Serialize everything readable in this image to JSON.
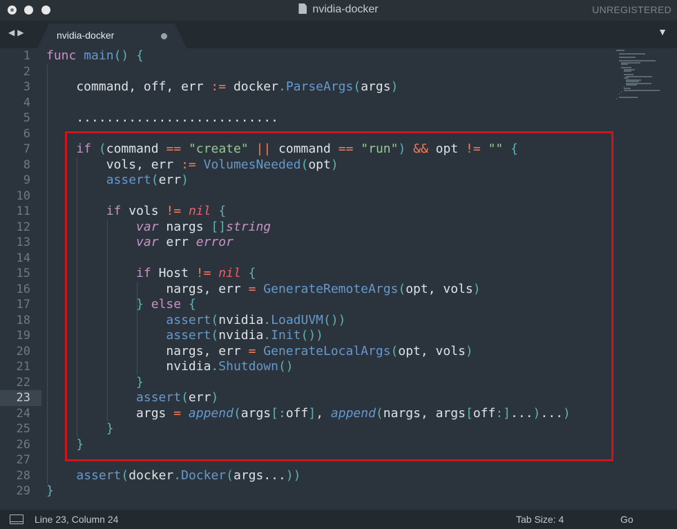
{
  "window": {
    "title": "nvidia-docker",
    "license_status": "UNREGISTERED"
  },
  "tabbar": {
    "nav_back": "◀",
    "nav_forward": "▶",
    "active_tab": "nvidia-docker",
    "menu_glyph": "▼"
  },
  "editor": {
    "active_line": 23,
    "line_numbers": [
      "1",
      "2",
      "3",
      "4",
      "5",
      "6",
      "7",
      "8",
      "9",
      "10",
      "11",
      "12",
      "13",
      "14",
      "15",
      "16",
      "17",
      "18",
      "19",
      "20",
      "21",
      "22",
      "23",
      "24",
      "25",
      "26",
      "27",
      "28",
      "29"
    ],
    "lines": [
      [
        [
          "k",
          "func"
        ],
        [
          "t",
          " "
        ],
        [
          "f",
          "main"
        ],
        [
          "p",
          "()"
        ],
        [
          "t",
          " "
        ],
        [
          "p",
          "{"
        ]
      ],
      [],
      [
        [
          "t",
          "    command, off, err "
        ],
        [
          "o",
          ":="
        ],
        [
          "t",
          " docker"
        ],
        [
          "p",
          "."
        ],
        [
          "f",
          "ParseArgs"
        ],
        [
          "p",
          "("
        ],
        [
          "t",
          "args"
        ],
        [
          "p",
          ")"
        ]
      ],
      [],
      [
        [
          "t",
          "    ..........................."
        ]
      ],
      [],
      [
        [
          "t",
          "    "
        ],
        [
          "k",
          "if"
        ],
        [
          "t",
          " "
        ],
        [
          "p",
          "("
        ],
        [
          "t",
          "command "
        ],
        [
          "o",
          "=="
        ],
        [
          "t",
          " "
        ],
        [
          "s",
          "\"create\""
        ],
        [
          "t",
          " "
        ],
        [
          "o",
          "||"
        ],
        [
          "t",
          " command "
        ],
        [
          "o",
          "=="
        ],
        [
          "t",
          " "
        ],
        [
          "s",
          "\"run\""
        ],
        [
          "p",
          ")"
        ],
        [
          "t",
          " "
        ],
        [
          "o",
          "&&"
        ],
        [
          "t",
          " opt "
        ],
        [
          "o",
          "!="
        ],
        [
          "t",
          " "
        ],
        [
          "s",
          "\"\""
        ],
        [
          "t",
          " "
        ],
        [
          "p",
          "{"
        ]
      ],
      [
        [
          "t",
          "        vols, err "
        ],
        [
          "o",
          ":="
        ],
        [
          "t",
          " "
        ],
        [
          "f",
          "VolumesNeeded"
        ],
        [
          "p",
          "("
        ],
        [
          "t",
          "opt"
        ],
        [
          "p",
          ")"
        ]
      ],
      [
        [
          "t",
          "        "
        ],
        [
          "f",
          "assert"
        ],
        [
          "p",
          "("
        ],
        [
          "t",
          "err"
        ],
        [
          "p",
          ")"
        ]
      ],
      [],
      [
        [
          "t",
          "        "
        ],
        [
          "k",
          "if"
        ],
        [
          "t",
          " vols "
        ],
        [
          "o",
          "!="
        ],
        [
          "t",
          " "
        ],
        [
          "n",
          "nil"
        ],
        [
          "t",
          " "
        ],
        [
          "p",
          "{"
        ]
      ],
      [
        [
          "t",
          "            "
        ],
        [
          "ki",
          "var"
        ],
        [
          "t",
          " nargs "
        ],
        [
          "p",
          "[]"
        ],
        [
          "ki",
          "string"
        ]
      ],
      [
        [
          "t",
          "            "
        ],
        [
          "ki",
          "var"
        ],
        [
          "t",
          " err "
        ],
        [
          "ki",
          "error"
        ]
      ],
      [],
      [
        [
          "t",
          "            "
        ],
        [
          "k",
          "if"
        ],
        [
          "t",
          " Host "
        ],
        [
          "o",
          "!="
        ],
        [
          "t",
          " "
        ],
        [
          "n",
          "nil"
        ],
        [
          "t",
          " "
        ],
        [
          "p",
          "{"
        ]
      ],
      [
        [
          "t",
          "                nargs, err "
        ],
        [
          "o",
          "="
        ],
        [
          "t",
          " "
        ],
        [
          "f",
          "GenerateRemoteArgs"
        ],
        [
          "p",
          "("
        ],
        [
          "t",
          "opt, vols"
        ],
        [
          "p",
          ")"
        ]
      ],
      [
        [
          "t",
          "            "
        ],
        [
          "p",
          "}"
        ],
        [
          "t",
          " "
        ],
        [
          "k",
          "else"
        ],
        [
          "t",
          " "
        ],
        [
          "p",
          "{"
        ]
      ],
      [
        [
          "t",
          "                "
        ],
        [
          "f",
          "assert"
        ],
        [
          "p",
          "("
        ],
        [
          "t",
          "nvidia"
        ],
        [
          "p",
          "."
        ],
        [
          "f",
          "LoadUVM"
        ],
        [
          "p",
          "())"
        ]
      ],
      [
        [
          "t",
          "                "
        ],
        [
          "f",
          "assert"
        ],
        [
          "p",
          "("
        ],
        [
          "t",
          "nvidia"
        ],
        [
          "p",
          "."
        ],
        [
          "f",
          "Init"
        ],
        [
          "p",
          "())"
        ]
      ],
      [
        [
          "t",
          "                nargs, err "
        ],
        [
          "o",
          "="
        ],
        [
          "t",
          " "
        ],
        [
          "f",
          "GenerateLocalArgs"
        ],
        [
          "p",
          "("
        ],
        [
          "t",
          "opt, vols"
        ],
        [
          "p",
          ")"
        ]
      ],
      [
        [
          "t",
          "                nvidia"
        ],
        [
          "p",
          "."
        ],
        [
          "f",
          "Shutdown"
        ],
        [
          "p",
          "()"
        ]
      ],
      [
        [
          "t",
          "            "
        ],
        [
          "p",
          "}"
        ]
      ],
      [
        [
          "t",
          "            "
        ],
        [
          "f",
          "assert"
        ],
        [
          "p",
          "("
        ],
        [
          "t",
          "err"
        ],
        [
          "p",
          ")"
        ]
      ],
      [
        [
          "t",
          "            args "
        ],
        [
          "o",
          "="
        ],
        [
          "t",
          " "
        ],
        [
          "fi",
          "append"
        ],
        [
          "p",
          "("
        ],
        [
          "t",
          "args"
        ],
        [
          "p",
          "[:"
        ],
        [
          "t",
          "off"
        ],
        [
          "p",
          "]"
        ],
        [
          "t",
          ", "
        ],
        [
          "fi",
          "append"
        ],
        [
          "p",
          "("
        ],
        [
          "t",
          "nargs, args"
        ],
        [
          "p",
          "["
        ],
        [
          "t",
          "off"
        ],
        [
          "p",
          ":]"
        ],
        [
          "t",
          "..."
        ],
        [
          "p",
          ")"
        ],
        [
          "t",
          "..."
        ],
        [
          "p",
          ")"
        ]
      ],
      [
        [
          "t",
          "        "
        ],
        [
          "p",
          "}"
        ]
      ],
      [
        [
          "t",
          "    "
        ],
        [
          "p",
          "}"
        ]
      ],
      [],
      [
        [
          "t",
          "    "
        ],
        [
          "f",
          "assert"
        ],
        [
          "p",
          "("
        ],
        [
          "t",
          "docker"
        ],
        [
          "p",
          "."
        ],
        [
          "f",
          "Docker"
        ],
        [
          "p",
          "("
        ],
        [
          "t",
          "args..."
        ],
        [
          "p",
          "))"
        ]
      ],
      [
        [
          "p",
          "}"
        ]
      ]
    ]
  },
  "statusbar": {
    "cursor_position": "Line 23, Column 24",
    "tab_size": "Tab Size: 4",
    "syntax": "Go"
  },
  "colors": {
    "background": "#2b343c",
    "highlight_border": "#d0141c",
    "keyword": "#c594c5",
    "function": "#6699cc",
    "string": "#99c794",
    "operator": "#f97b58",
    "nil": "#ec5f67",
    "punctuation": "#5fb3b3"
  }
}
